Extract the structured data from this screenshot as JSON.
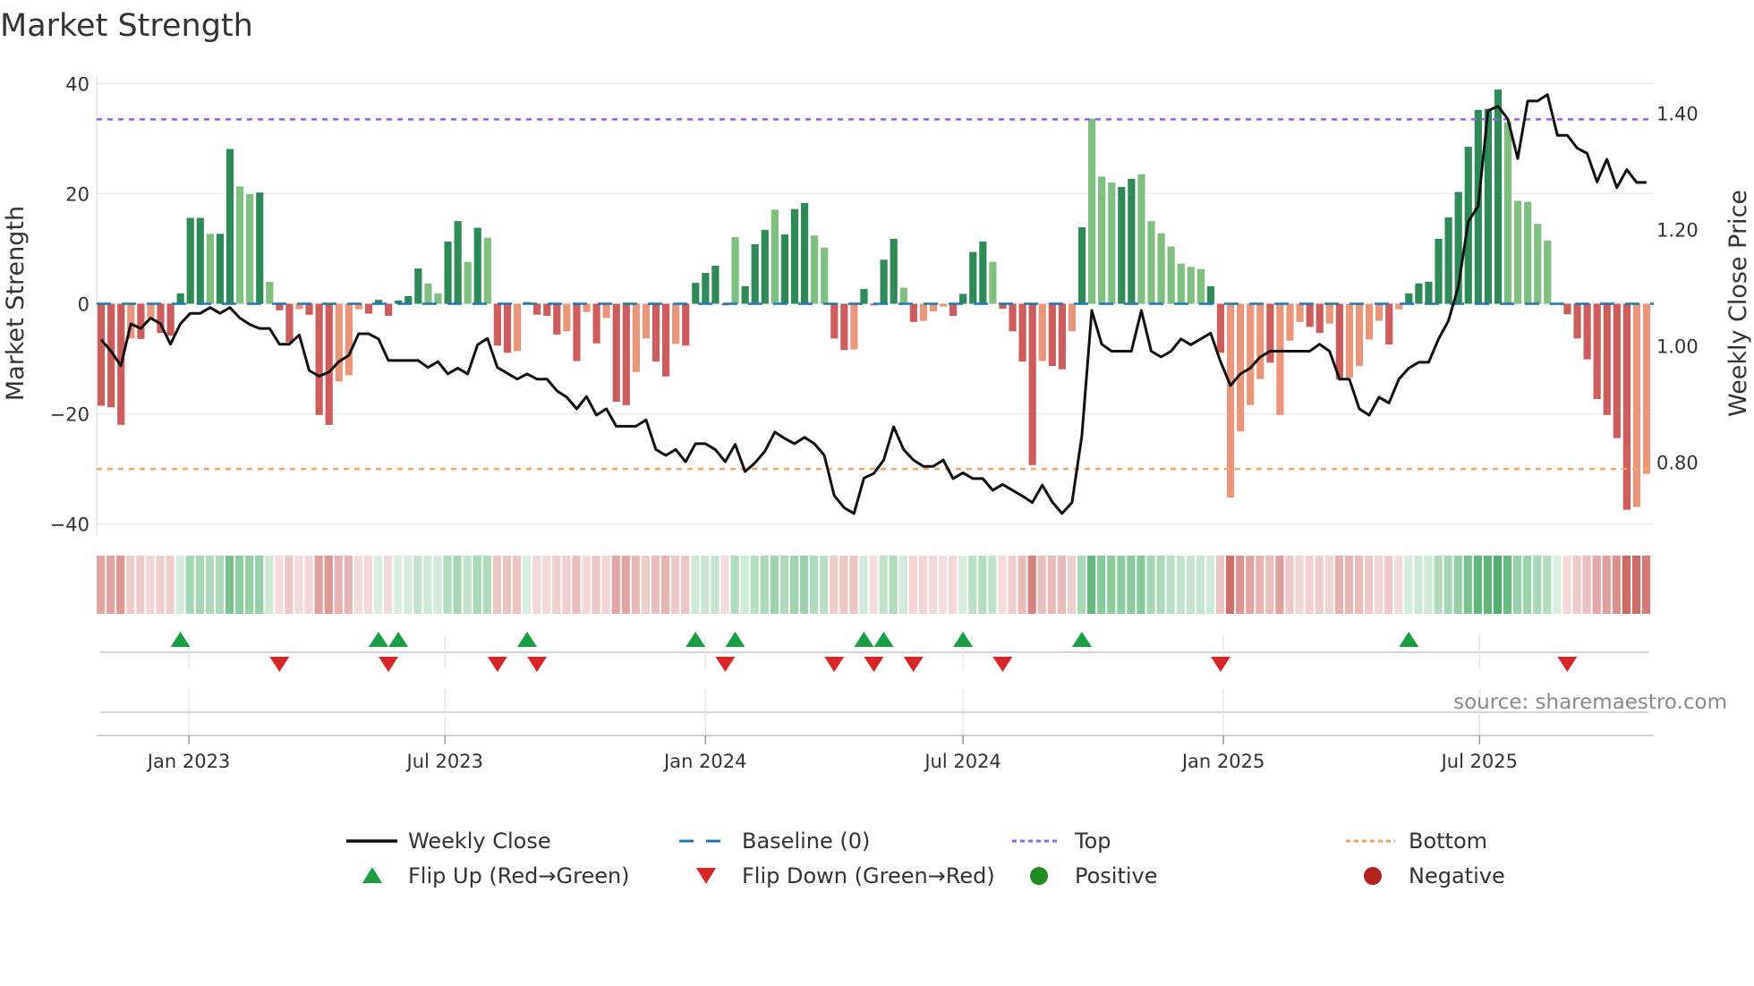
{
  "chart_data": {
    "type": "bar",
    "title": "Market Strength",
    "ylabel": "Market Strength",
    "y2label": "Weekly Close Price",
    "ylim": [
      -42,
      42
    ],
    "y2lim": [
      0.675,
      1.47
    ],
    "yticks": [
      {
        "value": 40,
        "label": "40"
      },
      {
        "value": 20,
        "label": "20"
      },
      {
        "value": 0,
        "label": "0"
      },
      {
        "value": -20,
        "label": "−20"
      },
      {
        "value": -40,
        "label": "−40"
      }
    ],
    "y2ticks": [
      {
        "value": 0.8,
        "label": "0.80"
      },
      {
        "value": 1.0,
        "label": "1.00"
      },
      {
        "value": 1.2,
        "label": "1.20"
      },
      {
        "value": 1.4,
        "label": "1.40"
      }
    ],
    "xticks": [
      {
        "date": "2023-01-01",
        "label": "Jan 2023"
      },
      {
        "date": "2023-07-01",
        "label": "Jul 2023"
      },
      {
        "date": "2024-01-01",
        "label": "Jan 2024"
      },
      {
        "date": "2024-07-01",
        "label": "Jul 2024"
      },
      {
        "date": "2025-01-01",
        "label": "Jan 2025"
      },
      {
        "date": "2025-07-01",
        "label": "Jul 2025"
      }
    ],
    "first_week": "2022-10-31",
    "frequency": "weekly",
    "top_level": 33.5,
    "bottom_level": -30,
    "baseline": 0,
    "strength": [
      -18.5,
      -18.8,
      -22,
      -6.3,
      -6.4,
      -2.6,
      -5.3,
      -5.8,
      1.9,
      15.6,
      15.6,
      12.7,
      12.7,
      28.1,
      21.3,
      19.9,
      20.2,
      4,
      -1.2,
      -7,
      -1,
      -2,
      -20.2,
      -22,
      -14.1,
      -13,
      -1,
      -1.8,
      0.7,
      -2.2,
      0.6,
      1.4,
      6.4,
      3.7,
      1.9,
      11.3,
      15,
      7.6,
      13.8,
      12,
      -7.6,
      -8.9,
      -8.6,
      0.3,
      -2,
      -2.2,
      -5.6,
      -5,
      -10.4,
      -1.5,
      -7.2,
      -2.6,
      -17.8,
      -18.4,
      -12.4,
      -6.3,
      -10.5,
      -13.2,
      -7.3,
      -7.6,
      3.8,
      5.6,
      6.9,
      -0.3,
      12.1,
      3.2,
      10.8,
      13.4,
      17.1,
      12.6,
      17.2,
      18.3,
      12.4,
      10.2,
      -6.3,
      -8.4,
      -8.3,
      2.7,
      -0.3,
      8,
      11.8,
      2.9,
      -3.3,
      -3.1,
      -1.4,
      -0.5,
      -2.2,
      1.8,
      9.4,
      11.3,
      7.6,
      -0.9,
      -5,
      -10.5,
      -29.3,
      -10.4,
      -11.3,
      -11.9,
      -5,
      13.9,
      33.6,
      23.1,
      22,
      21.2,
      22.7,
      23.5,
      15,
      12.8,
      10.4,
      7.3,
      6.7,
      6.3,
      3.2,
      -8.9,
      -35.2,
      -23.2,
      -18.4,
      -13.7,
      -10.7,
      -20.2,
      -6.7,
      -3.3,
      -4.2,
      -5.3,
      -3.6,
      -13.8,
      -13.4,
      -11.3,
      -6.5,
      -3.1,
      -7.4,
      -1,
      1.9,
      3.7,
      4,
      11.8,
      15.7,
      20.3,
      28.5,
      35.2,
      35.4,
      38.9,
      33,
      18.7,
      18.5,
      14.5,
      11.5,
      0,
      -1.9,
      -6.3,
      -10.1,
      -17.3,
      -20.2,
      -24.4,
      -37.4,
      -36.9,
      -30.9
    ],
    "strong": "1110101111101100101101110001111110011010110111101010110011011111011101110011011110100011110111101101000110000000110000100011010000101111111111000000111111100",
    "weekly_close": [
      1.011,
      0.991,
      0.966,
      1.038,
      1.03,
      1.048,
      1.038,
      1.003,
      1.038,
      1.056,
      1.056,
      1.066,
      1.056,
      1.066,
      1.048,
      1.037,
      1.03,
      1.03,
      1.003,
      1.003,
      1.019,
      0.958,
      0.948,
      0.955,
      0.973,
      0.984,
      1.021,
      1.021,
      1.012,
      0.975,
      0.975,
      0.975,
      0.975,
      0.963,
      0.973,
      0.952,
      0.962,
      0.952,
      1.002,
      1.013,
      0.963,
      0.953,
      0.943,
      0.952,
      0.943,
      0.943,
      0.923,
      0.912,
      0.892,
      0.913,
      0.881,
      0.892,
      0.862,
      0.862,
      0.862,
      0.873,
      0.822,
      0.812,
      0.822,
      0.801,
      0.832,
      0.832,
      0.822,
      0.801,
      0.831,
      0.784,
      0.799,
      0.819,
      0.852,
      0.841,
      0.832,
      0.843,
      0.832,
      0.812,
      0.743,
      0.722,
      0.712,
      0.773,
      0.781,
      0.804,
      0.861,
      0.822,
      0.804,
      0.793,
      0.793,
      0.804,
      0.772,
      0.782,
      0.772,
      0.772,
      0.752,
      0.762,
      0.752,
      0.742,
      0.731,
      0.761,
      0.732,
      0.712,
      0.731,
      0.845,
      1.061,
      1.003,
      0.991,
      0.991,
      0.991,
      1.061,
      0.991,
      0.981,
      0.991,
      1.012,
      1.002,
      1.012,
      1.022,
      0.973,
      0.932,
      0.952,
      0.962,
      0.981,
      0.991,
      0.991,
      0.991,
      0.991,
      0.991,
      1.003,
      0.991,
      0.943,
      0.943,
      0.892,
      0.881,
      0.912,
      0.902,
      0.943,
      0.962,
      0.972,
      0.972,
      1.012,
      1.043,
      1.102,
      1.214,
      1.24,
      1.404,
      1.412,
      1.39,
      1.322,
      1.421,
      1.421,
      1.432,
      1.362,
      1.362,
      1.34,
      1.331,
      1.282,
      1.321,
      1.272,
      1.303,
      1.281,
      1.281
    ],
    "flip_up_weeks": [
      8,
      28,
      30,
      43,
      60,
      64,
      77,
      79,
      87,
      99,
      132
    ],
    "flip_down_weeks": [
      18,
      29,
      40,
      44,
      63,
      74,
      78,
      82,
      91,
      113,
      148
    ],
    "legend": {
      "weekly_close": "Weekly Close",
      "baseline": "Baseline (0)",
      "top": "Top",
      "bottom": "Bottom",
      "flip_up": "Flip Up (Red→Green)",
      "flip_down": "Flip Down (Green→Red)",
      "positive": "Positive",
      "negative": "Negative",
      "placement": "bottom"
    },
    "source": "source: sharemaestro.com",
    "colors": {
      "strong_pos": "#2e8b57",
      "weak_pos": "#7fbf7f",
      "strong_neg": "#cd5c5c",
      "weak_neg": "#e9967a",
      "baseline": "#1f77b4",
      "top": "#9b5de5",
      "bottom": "#f4a460",
      "close": "#111111",
      "flip_up": "#1a9e44",
      "flip_down": "#d62728",
      "positive": "#228b22",
      "negative": "#b22222",
      "strip_pos": "#3aa65a",
      "strip_neg": "#c44e48"
    }
  }
}
